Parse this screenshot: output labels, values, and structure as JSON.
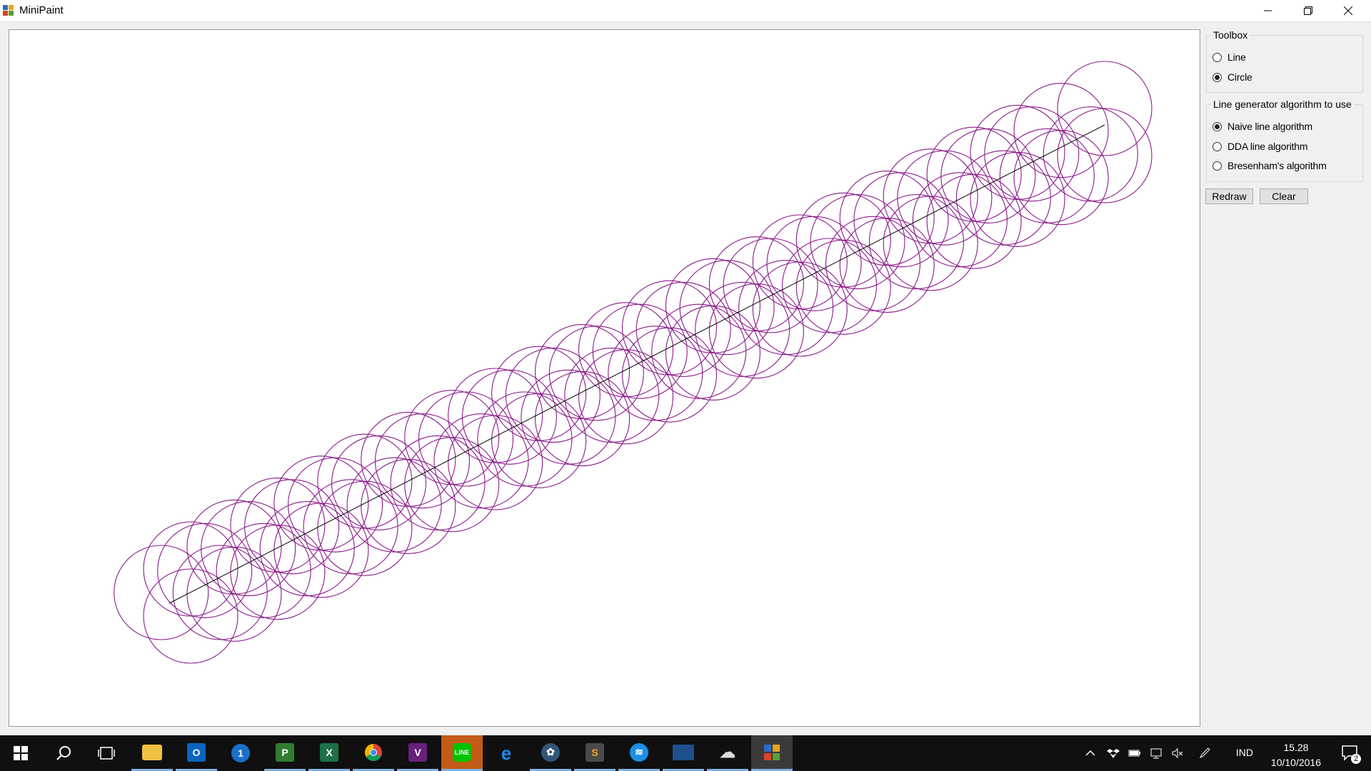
{
  "window": {
    "title": "MiniPaint"
  },
  "toolbox": {
    "title": "Toolbox",
    "options": [
      {
        "label": "Line",
        "checked": false
      },
      {
        "label": "Circle",
        "checked": true
      }
    ]
  },
  "algorithm": {
    "title": "Line generator algorithm to use",
    "options": [
      {
        "label": "Naive line algorithm",
        "checked": true
      },
      {
        "label": "DDA line algorithm",
        "checked": false
      },
      {
        "label": "Bresenham's algorithm",
        "checked": false
      }
    ]
  },
  "buttons": {
    "redraw": "Redraw",
    "clear": "Clear"
  },
  "drawing": {
    "circle_color": "#8b1a8b",
    "line_color": "#000000"
  },
  "taskbar": {
    "apps": [
      "start-icon",
      "search-icon",
      "task-view-icon",
      "file-explorer-icon",
      "outlook-icon",
      "1password-icon",
      "project-icon",
      "excel-icon",
      "chrome-icon",
      "visual-studio-icon",
      "line-messenger-icon",
      "edge-icon",
      "app-icon",
      "sublime-text-icon",
      "wifi-app-icon",
      "window-icon",
      "cloud-app-icon",
      "minipaint-icon"
    ],
    "language": "IND",
    "time": "15.28",
    "date": "10/10/2016",
    "notification_count": "2"
  }
}
